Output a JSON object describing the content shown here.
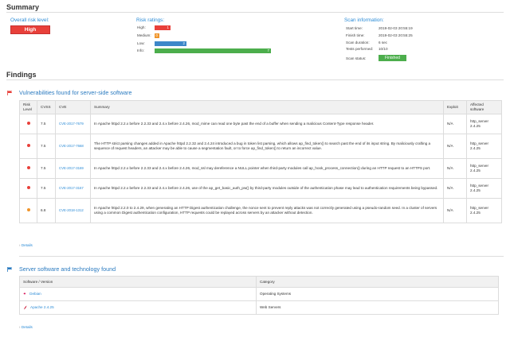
{
  "summary": {
    "title": "Summary",
    "overall_label": "Overall risk level:",
    "overall_value": "High",
    "risk_label": "Risk ratings:",
    "ratings": [
      {
        "name": "High:",
        "count": "1",
        "color": "#e8403a"
      },
      {
        "name": "Medium:",
        "count": "0",
        "color": "#f0952b"
      },
      {
        "name": "Low:",
        "count": "2",
        "color": "#3d87c9"
      },
      {
        "name": "Info:",
        "count": "7",
        "color": "#4cae4c"
      }
    ],
    "scan_label": "Scan information:",
    "scan": [
      {
        "k": "Start time:",
        "v": "2019-02-03 20:55:19"
      },
      {
        "k": "Finish time:",
        "v": "2019-02-03 20:55:25"
      },
      {
        "k": "Scan duration:",
        "v": "6 sec"
      },
      {
        "k": "Tests performed:",
        "v": "10/10"
      },
      {
        "k": "Scan status:",
        "v": "Finished"
      }
    ]
  },
  "findings": {
    "title": "Findings",
    "vuln_title": "Vulnerabilities found for server-side software",
    "headers": {
      "risk": "Risk Level",
      "cvss": "CVSS",
      "cve": "CVE",
      "summary": "Summary",
      "exploit": "Exploit",
      "affected": "Affected software"
    },
    "rows": [
      {
        "color": "#e8403a",
        "cvss": "7.5",
        "cve": "CVE-2017-7679",
        "summary": "In Apache httpd 2.2.x before 2.2.33 and 2.4.x before 2.4.26, mod_mime can read one byte past the end of a buffer when sending a malicious Content-Type response header.",
        "exploit": "N/A",
        "affected": "http_server 2.4.25"
      },
      {
        "color": "#e8403a",
        "cvss": "7.5",
        "cve": "CVE-2017-7668",
        "summary": "The HTTP strict parsing changes added in Apache httpd 2.2.32 and 2.4.24 introduced a bug in token list parsing, which allows ap_find_token() to search past the end of its input string. By maliciously crafting a sequence of request headers, an attacker may be able to cause a segmentation fault, or to force ap_find_token() to return an incorrect value.",
        "exploit": "N/A",
        "affected": "http_server 2.4.25"
      },
      {
        "color": "#e8403a",
        "cvss": "7.5",
        "cve": "CVE-2017-3169",
        "summary": "In Apache httpd 2.2.x before 2.2.33 and 2.4.x before 2.4.26, mod_ssl may dereference a NULL pointer when third-party modules call ap_hook_process_connection() during an HTTP request to an HTTPS port.",
        "exploit": "N/A",
        "affected": "http_server 2.4.25"
      },
      {
        "color": "#e8403a",
        "cvss": "7.5",
        "cve": "CVE-2017-3167",
        "summary": "In Apache httpd 2.2.x before 2.2.33 and 2.4.x before 2.4.26, use of the ap_get_basic_auth_pw() by third-party modules outside of the authentication phase may lead to authentication requirements being bypassed.",
        "exploit": "N/A",
        "affected": "http_server 2.4.25"
      },
      {
        "color": "#f0952b",
        "cvss": "6.8",
        "cve": "CVE-2018-1312",
        "summary": "In Apache httpd 2.2.0 to 2.4.29, when generating an HTTP Digest authentication challenge, the nonce sent to prevent reply attacks was not correctly generated using a pseudo-random seed. In a cluster of servers using a common Digest authentication configuration, HTTP requests could be replayed across servers by an attacker without detection.",
        "exploit": "N/A",
        "affected": "http_server 2.4.25"
      }
    ],
    "details_label": "Details",
    "sw_title": "Server software and technology found",
    "sw_headers": {
      "software": "Software / Version",
      "category": "Category"
    },
    "sw_rows": [
      {
        "software": "Debian",
        "category": "Operating Systems",
        "icon_color": "#d70a53"
      },
      {
        "software": "Apache 2.4.25",
        "category": "Web Servers",
        "icon_color": "#c8102e"
      }
    ]
  }
}
